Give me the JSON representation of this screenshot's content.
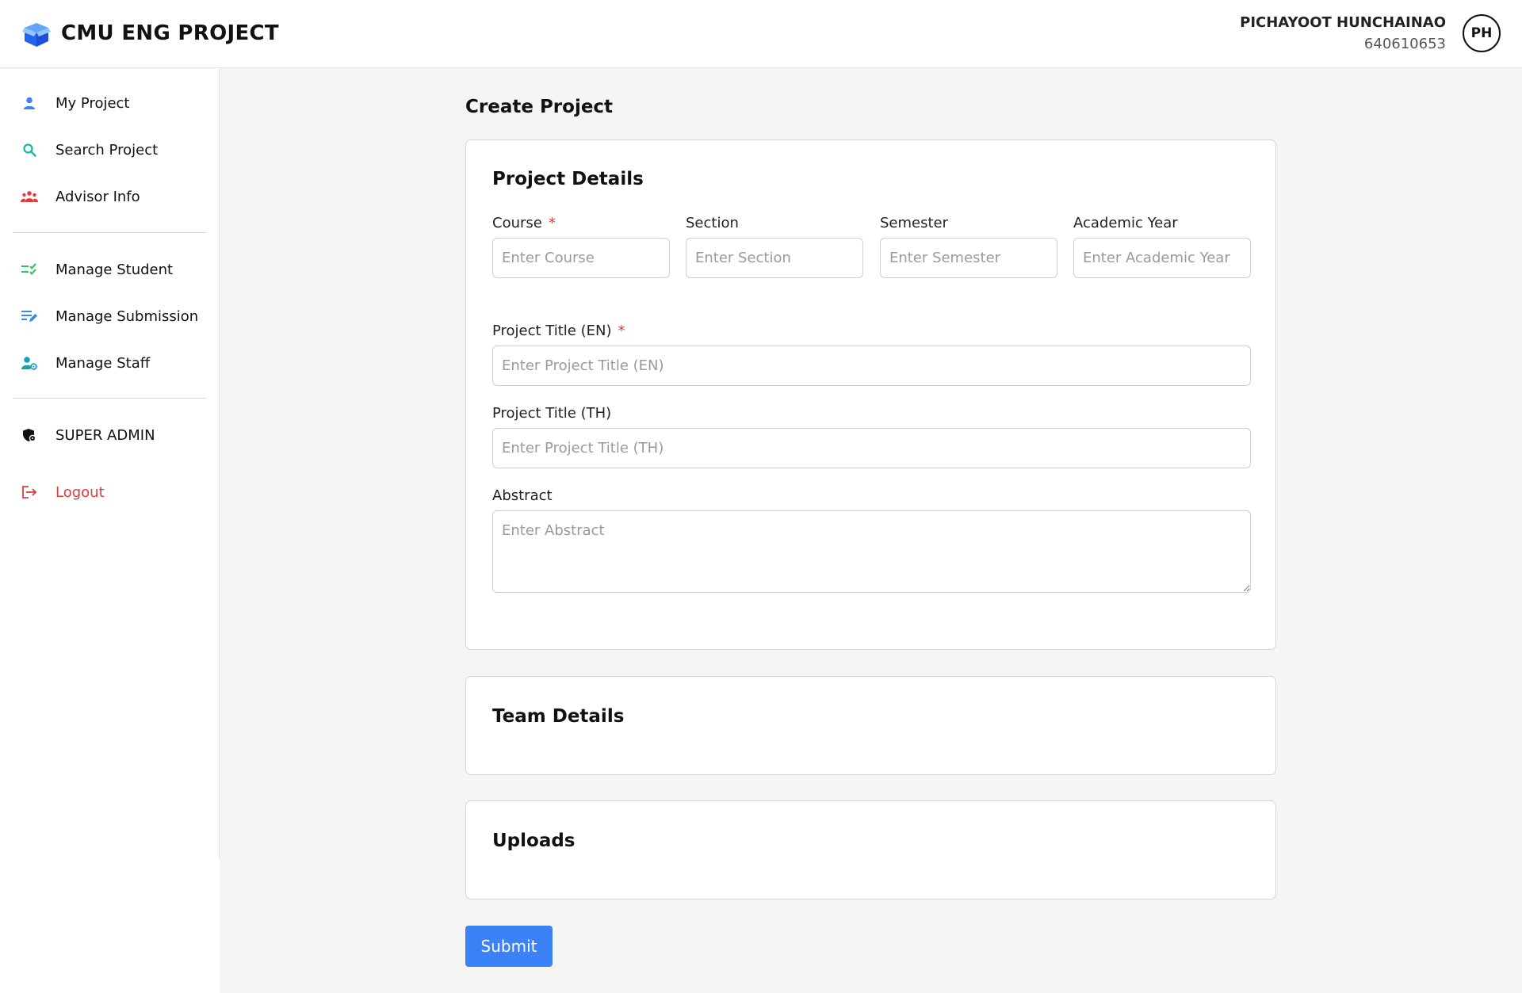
{
  "header": {
    "app_title": "CMU ENG PROJECT",
    "logo_icon": "box-icon",
    "user_name": "PICHAYOOT HUNCHAINAO",
    "user_id": "640610653",
    "avatar_initials": "PH"
  },
  "sidebar": {
    "items": [
      {
        "label": "My Project",
        "icon": "user-icon",
        "color": "#3b82f6"
      },
      {
        "label": "Search Project",
        "icon": "search-icon",
        "color": "#14b8a6"
      },
      {
        "label": "Advisor Info",
        "icon": "group-icon",
        "color": "#e23b3b"
      },
      {
        "label": "Manage Student",
        "icon": "checklist-icon",
        "color": "#22c55e"
      },
      {
        "label": "Manage Submission",
        "icon": "edit-list-icon",
        "color": "#3b82f6"
      },
      {
        "label": "Manage Staff",
        "icon": "user-settings-icon",
        "color": "#0ea5b7"
      },
      {
        "label": "SUPER ADMIN",
        "icon": "shield-gear-icon",
        "color": "#111111"
      },
      {
        "label": "Logout",
        "icon": "logout-icon",
        "color": "#e23b3b"
      }
    ]
  },
  "main": {
    "page_title": "Create Project",
    "project_details": {
      "title": "Project Details",
      "course": {
        "label": "Course",
        "required": "*",
        "placeholder": "Enter Course",
        "value": ""
      },
      "section": {
        "label": "Section",
        "placeholder": "Enter Section",
        "value": ""
      },
      "semester": {
        "label": "Semester",
        "placeholder": "Enter Semester",
        "value": ""
      },
      "academic_year": {
        "label": "Academic Year",
        "placeholder": "Enter Academic Year",
        "value": ""
      },
      "title_en": {
        "label": "Project Title (EN)",
        "required": "*",
        "placeholder": "Enter Project Title (EN)",
        "value": ""
      },
      "title_th": {
        "label": "Project Title (TH)",
        "placeholder": "Enter Project Title (TH)",
        "value": ""
      },
      "abstract": {
        "label": "Abstract",
        "placeholder": "Enter Abstract",
        "value": ""
      }
    },
    "team_details": {
      "title": "Team Details"
    },
    "uploads": {
      "title": "Uploads"
    },
    "submit_label": "Submit"
  },
  "colors": {
    "accent": "#3b82f6",
    "danger": "#e23b3b",
    "background": "#f5f5f4"
  }
}
